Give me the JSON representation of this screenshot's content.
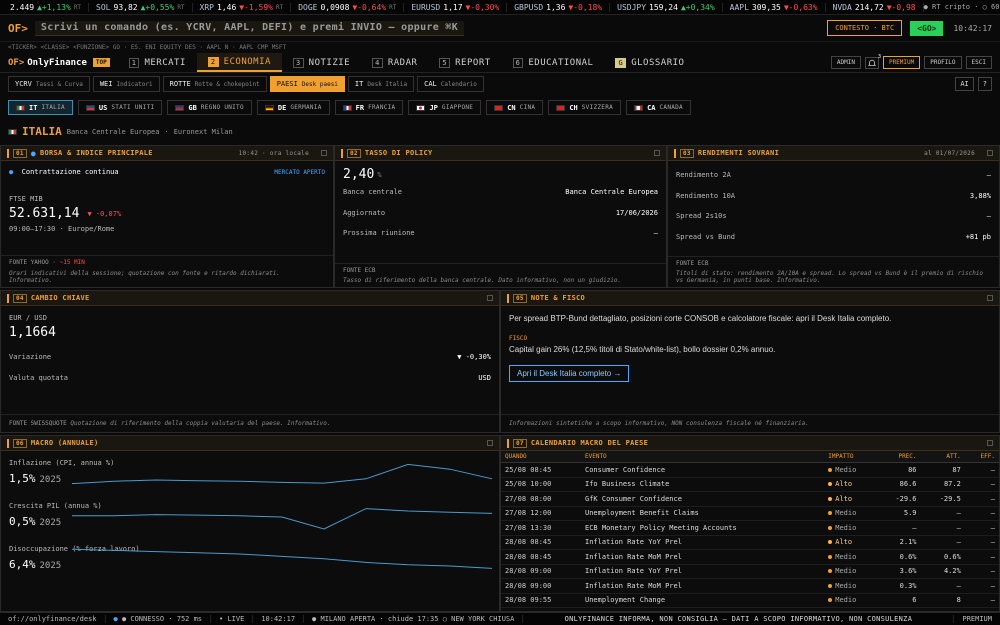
{
  "ticker": [
    {
      "sym": "",
      "price": "2.449",
      "chg": "▲+1,13%",
      "dir": "up",
      "sfx": "RT"
    },
    {
      "sym": "SOL",
      "price": "93,82",
      "chg": "▲+0,55%",
      "dir": "up",
      "sfx": "RT"
    },
    {
      "sym": "XRP",
      "price": "1,46",
      "chg": "▼-1,59%",
      "dir": "dn",
      "sfx": "RT"
    },
    {
      "sym": "DOGE",
      "price": "0,0908",
      "chg": "▼-0,64%",
      "dir": "dn",
      "sfx": "RT"
    },
    {
      "sym": "EURUSD",
      "price": "1,17",
      "chg": "▼-0,30%",
      "dir": "dn",
      "sfx": ""
    },
    {
      "sym": "GBPUSD",
      "price": "1,36",
      "chg": "▼-0,18%",
      "dir": "dn",
      "sfx": ""
    },
    {
      "sym": "USDJPY",
      "price": "159,24",
      "chg": "▲+0,34%",
      "dir": "up",
      "sfx": ""
    },
    {
      "sym": "AAPL",
      "price": "309,35",
      "chg": "▼-0,63%",
      "dir": "dn",
      "sfx": ""
    },
    {
      "sym": "NVDA",
      "price": "214,72",
      "chg": "▼-0,98",
      "dir": "dn",
      "sfx": ""
    }
  ],
  "ticker_right": "● RT cripto · ○ 60s",
  "cmd": {
    "prompt": "OF>",
    "placeholder": "Scrivi un comando (es. YCRV, AAPL, DEFI) e premi INVIO — oppure ⌘K",
    "context": "CONTESTO · BTC",
    "go": "<GO>",
    "clock": "10:42:17"
  },
  "hint": "<TICKER> <CLASSE> <FUNZIONE> GO · ES. ENI EQUITY DES · AAPL N · AAPL CMP MSFT",
  "nav": {
    "brand_prefix": "OF>",
    "brand": "OnlyFinance",
    "badge": "TOP",
    "tabs": [
      {
        "n": "1",
        "label": "MERCATI",
        "cls": ""
      },
      {
        "n": "2",
        "label": "ECONOMIA",
        "cls": "act"
      },
      {
        "n": "3",
        "label": "NOTIZIE",
        "cls": ""
      },
      {
        "n": "4",
        "label": "RADAR",
        "cls": ""
      },
      {
        "n": "5",
        "label": "REPORT",
        "cls": ""
      },
      {
        "n": "6",
        "label": "EDUCATIONAL",
        "cls": ""
      },
      {
        "n": "G",
        "label": "GLOSSARIO",
        "cls": "gl"
      }
    ],
    "admin": "ADMIN",
    "bell_count": "3",
    "premium": "PREMIUM",
    "profile": "PROFILO",
    "exit": "ESCI"
  },
  "subnav": [
    {
      "code": "YCRV",
      "label": "Tassi & Curva",
      "act": false
    },
    {
      "code": "WEI",
      "label": "Indicatori",
      "act": false
    },
    {
      "code": "ROTTE",
      "label": "Rotte & chokepoint",
      "act": false
    },
    {
      "code": "PAESI",
      "label": "Desk paesi",
      "act": true
    },
    {
      "code": "IT",
      "label": "Desk Italia",
      "act": false
    },
    {
      "code": "CAL",
      "label": "Calendario",
      "act": false
    }
  ],
  "subnav_ai": "AI",
  "subnav_help": "?",
  "countries": [
    {
      "code": "IT",
      "name": "ITALIA",
      "act": true,
      "flag": "linear-gradient(90deg,#2a8a3a 33%,#fff 33% 66%,#d33 66%)"
    },
    {
      "code": "US",
      "name": "STATI UNITI",
      "act": false,
      "flag": "linear-gradient(#2a4a9a 45%,#d33 45%)"
    },
    {
      "code": "GB",
      "name": "REGNO UNITO",
      "act": false,
      "flag": "linear-gradient(#223a80,#c33)"
    },
    {
      "code": "DE",
      "name": "GERMANIA",
      "act": false,
      "flag": "linear-gradient(#111 33%,#d22 33% 66%,#f4c400 66%)"
    },
    {
      "code": "FR",
      "name": "FRANCIA",
      "act": false,
      "flag": "linear-gradient(90deg,#2340a0 33%,#fff 33% 66%,#d33 66%)"
    },
    {
      "code": "JP",
      "name": "GIAPPONE",
      "act": false,
      "flag": "radial-gradient(circle,#d22 35%,#fff 38%)"
    },
    {
      "code": "CN",
      "name": "CINA",
      "act": false,
      "flag": "linear-gradient(#d22,#d22)"
    },
    {
      "code": "CH",
      "name": "SVIZZERA",
      "act": false,
      "flag": "linear-gradient(#d22,#d22)"
    },
    {
      "code": "CA",
      "name": "CANADA",
      "act": false,
      "flag": "linear-gradient(90deg,#d22 25%,#fff 25% 75%,#d22 75%)"
    }
  ],
  "country": {
    "name": "ITALIA",
    "sub1": "Banca Centrale Europea",
    "sub2": "Euronext Milan"
  },
  "p1": {
    "num": "01",
    "title": "BORSA & INDICE PRINCIPALE",
    "meta": "10:42 · ora locale",
    "status": "Contrattazione continua",
    "market": "MERCATO APERTO",
    "idx_name": "FTSE MIB",
    "idx_value": "52.631,14",
    "idx_chg": "▼ -0,07%",
    "hours": "09:00–17:30 · Europe/Rome",
    "src": "FONTE YAHOO ·",
    "src_tag": "~15 MIN",
    "note": "Orari indicativi della sessione; quotazione con fonte e ritardo dichiarati. Informativo."
  },
  "p2": {
    "num": "02",
    "title": "TASSO DI POLICY",
    "rate": "2,40",
    "unit": "%",
    "rows": [
      [
        "Banca centrale",
        "Banca Centrale Europea"
      ],
      [
        "Aggiornato",
        "17/06/2026"
      ],
      [
        "Prossima riunione",
        "—"
      ]
    ],
    "src": "FONTE ECB",
    "note": "Tasso di riferimento della banca centrale. Dato informativo, non un giudizio."
  },
  "p3": {
    "num": "03",
    "title": "RENDIMENTI SOVRANI",
    "meta": "al 01/07/2026",
    "rows": [
      [
        "Rendimento 2A",
        "—"
      ],
      [
        "Rendimento 10A",
        "3,88%"
      ],
      [
        "Spread 2s10s",
        "—"
      ],
      [
        "Spread vs Bund",
        "+81 pb"
      ]
    ],
    "src": "FONTE ECB",
    "note": "Titoli di stato: rendimento 2A/10A e spread. Lo spread vs Bund è il premio di rischio vs Germania, in punti base. Informativo."
  },
  "p4": {
    "num": "04",
    "title": "CAMBIO CHIAVE",
    "pair": "EUR / USD",
    "value": "1,1664",
    "rows": [
      [
        "Variazione",
        "▼ -0,30%"
      ],
      [
        "Valuta quotata",
        "USD"
      ]
    ],
    "src": "FONTE SWISSQUOTE",
    "note": "Quotazione di riferimento della coppia valutaria del paese. Informativo."
  },
  "p5": {
    "num": "05",
    "title": "NOTE & FISCO",
    "text": "Per spread BTP-Bund dettagliato, posizioni corte CONSOB e calcolatore fiscale: apri il Desk Italia completo.",
    "label": "FISCO",
    "fisco": "Capital gain 26% (12,5% titoli di Stato/white-list), bollo dossier 0,2% annuo.",
    "button": "Apri il Desk Italia completo →",
    "note": "Informazioni sintetiche a scopo informativo, NON consulenza fiscale né finanziaria."
  },
  "p6": {
    "num": "06",
    "title": "MACRO (ANNUALE)",
    "items": [
      {
        "label": "Inflazione (CPI, annua %)",
        "value": "1,5%",
        "year": "2025",
        "spark": [
          0.1,
          0.2,
          0.25,
          0.22,
          0.2,
          0.15,
          0.12,
          0.3,
          0.9,
          0.7,
          0.3
        ]
      },
      {
        "label": "Crescita PIL (annua %)",
        "value": "0,5%",
        "year": "2025",
        "spark": [
          0.55,
          0.55,
          0.6,
          0.58,
          0.55,
          0.5,
          0.0,
          0.85,
          0.75,
          0.7,
          0.65
        ]
      },
      {
        "label": "Disoccupazione (% forza lavoro)",
        "value": "6,4%",
        "year": "2025",
        "spark": [
          0.95,
          0.9,
          0.85,
          0.8,
          0.75,
          0.65,
          0.55,
          0.4,
          0.3,
          0.25,
          0.15
        ]
      }
    ]
  },
  "p7": {
    "num": "07",
    "title": "CALENDARIO MACRO DEL PAESE",
    "headers": [
      "QUANDO",
      "EVENTO",
      "IMPATTO",
      "PREC.",
      "ATT.",
      "EFF."
    ],
    "rows": [
      [
        "25/08 08:45",
        "Consumer Confidence",
        "Medio",
        "86",
        "87",
        "—"
      ],
      [
        "25/08 10:00",
        "Ifo Business Climate",
        "Alto",
        "86.6",
        "87.2",
        "—"
      ],
      [
        "27/08 08:00",
        "GfK Consumer Confidence",
        "Alto",
        "-29.6",
        "-29.5",
        "—"
      ],
      [
        "27/08 12:00",
        "Unemployment Benefit Claims",
        "Medio",
        "5.9",
        "—",
        "—"
      ],
      [
        "27/08 13:30",
        "ECB Monetary Policy Meeting Accounts",
        "Medio",
        "—",
        "—",
        "—"
      ],
      [
        "28/08 08:45",
        "Inflation Rate YoY Prel",
        "Alto",
        "2.1%",
        "—",
        "—"
      ],
      [
        "28/08 08:45",
        "Inflation Rate MoM Prel",
        "Medio",
        "0.6%",
        "0.6%",
        "—"
      ],
      [
        "28/08 09:00",
        "Inflation Rate YoY Prel",
        "Medio",
        "3.6%",
        "4.2%",
        "—"
      ],
      [
        "28/08 09:00",
        "Inflation Rate MoM Prel",
        "Medio",
        "0.3%",
        "—",
        "—"
      ],
      [
        "28/08 09:55",
        "Unemployment Change",
        "Medio",
        "6",
        "8",
        "—"
      ]
    ]
  },
  "status": {
    "path": "of://onlyfinance/desk",
    "conn": "● CONNESSO · 752 ms",
    "live": "• LIVE",
    "clock": "10:42:17",
    "market": "● MILANO APERTA · chiude 17:35  ○ NEW YORK CHIUSA",
    "center": "ONLYFINANCE INFORMA, NON CONSIGLIA — DATI A SCOPO INFORMATIVO, NON CONSULENZA",
    "plan": "PREMIUM"
  }
}
